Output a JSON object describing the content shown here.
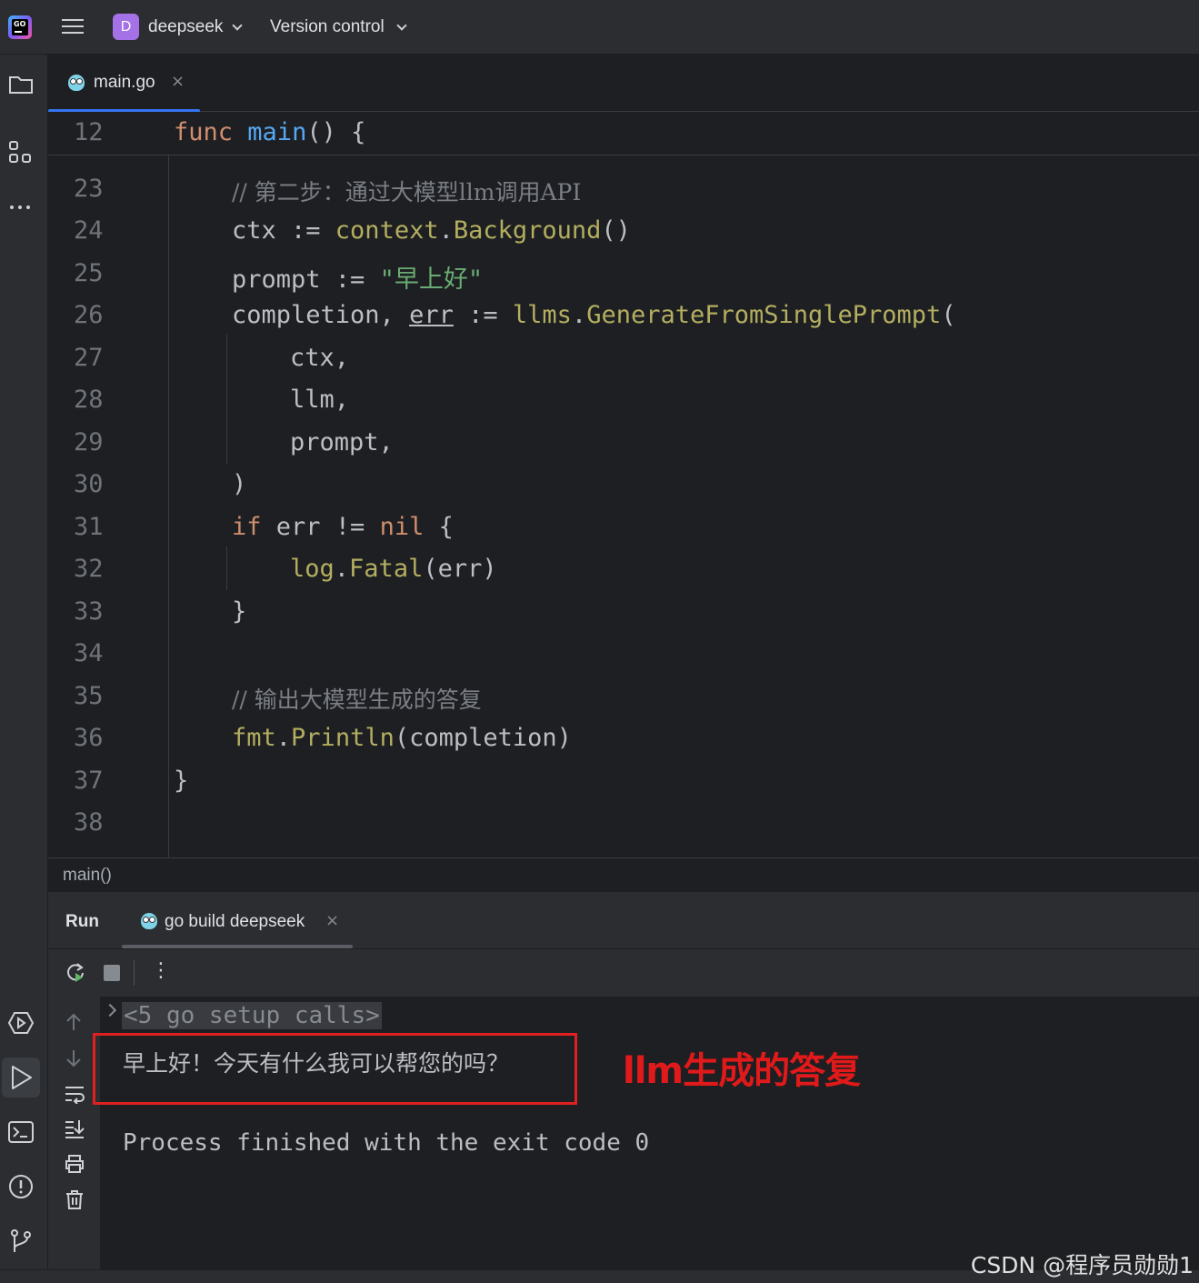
{
  "titlebar": {
    "logo_text": "GO",
    "project_badge": "D",
    "project_name": "deepseek",
    "version_control_label": "Version control"
  },
  "editor_tab": {
    "filename": "main.go",
    "close": "×"
  },
  "sticky_header": {
    "line_number": "12",
    "kw": "func",
    "name": "main",
    "rest": "() {"
  },
  "code_lines": [
    {
      "n": "23"
    },
    {
      "n": "24"
    },
    {
      "n": "25"
    },
    {
      "n": "26"
    },
    {
      "n": "27"
    },
    {
      "n": "28"
    },
    {
      "n": "29"
    },
    {
      "n": "30"
    },
    {
      "n": "31"
    },
    {
      "n": "32"
    },
    {
      "n": "33"
    },
    {
      "n": "34"
    },
    {
      "n": "35"
    },
    {
      "n": "36"
    },
    {
      "n": "37"
    },
    {
      "n": "38"
    }
  ],
  "code": {
    "l23_comment": "// 第二步：通过大模型llm调用API",
    "l24_a": "ctx := ",
    "l24_pkg": "context",
    "l24_dot": ".",
    "l24_fn": "Background",
    "l24_end": "()",
    "l25_a": "prompt := ",
    "l25_str": "\"早上好\"",
    "l26_a": "completion, ",
    "l26_err": "err",
    "l26_b": " := ",
    "l26_pkg": "llms",
    "l26_dot": ".",
    "l26_fn": "GenerateFromSinglePrompt",
    "l26_end": "(",
    "l27": "ctx,",
    "l28": "llm,",
    "l29": "prompt,",
    "l30": ")",
    "l31_kw": "if",
    "l31_a": " err != ",
    "l31_nil": "nil",
    "l31_end": " {",
    "l32_pkg": "log",
    "l32_dot": ".",
    "l32_fn": "Fatal",
    "l32_end": "(err)",
    "l33": "}",
    "l35_comment": "// 输出大模型生成的答复",
    "l36_pkg": "fmt",
    "l36_dot": ".",
    "l36_fn": "Println",
    "l36_end": "(completion)",
    "l37": "}"
  },
  "breadcrumb": "main()",
  "run_panel": {
    "title": "Run",
    "tab_label": "go build deepseek",
    "tab_close": "×",
    "more": "⋮"
  },
  "console": {
    "setup_calls": "<5 go setup calls>",
    "output": "早上好！今天有什么我可以帮您的吗？",
    "exit_message": "Process finished with the exit code 0"
  },
  "annotation": {
    "note": "llm生成的答复"
  },
  "watermark": "CSDN @程序员勋勋1",
  "colors": {
    "accent": "#3574f0",
    "annotation_red": "#e02020",
    "keyword": "#cf8e6d",
    "function": "#56a8f5",
    "string": "#6aab73"
  }
}
